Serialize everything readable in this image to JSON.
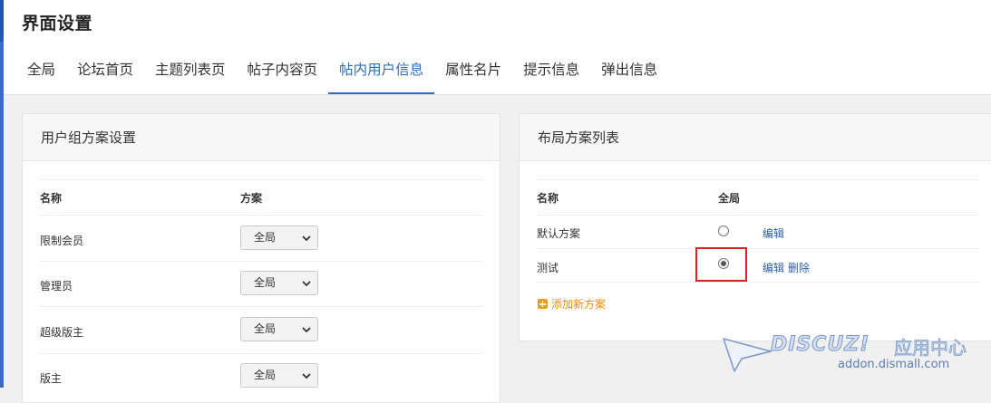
{
  "page": {
    "title": "界面设置"
  },
  "tabs": [
    {
      "label": "全局",
      "active": false
    },
    {
      "label": "论坛首页",
      "active": false
    },
    {
      "label": "主题列表页",
      "active": false
    },
    {
      "label": "帖子内容页",
      "active": false
    },
    {
      "label": "帖内用户信息",
      "active": true
    },
    {
      "label": "属性名片",
      "active": false
    },
    {
      "label": "提示信息",
      "active": false
    },
    {
      "label": "弹出信息",
      "active": false
    }
  ],
  "usergroup_panel": {
    "title": "用户组方案设置",
    "columns": [
      "名称",
      "方案"
    ],
    "rows": [
      {
        "name": "限制会员",
        "scheme": "全局"
      },
      {
        "name": "管理员",
        "scheme": "全局"
      },
      {
        "name": "超级版主",
        "scheme": "全局"
      },
      {
        "name": "版主",
        "scheme": "全局"
      }
    ]
  },
  "layout_panel": {
    "title": "布局方案列表",
    "columns": [
      "名称",
      "全局"
    ],
    "rows": [
      {
        "name": "默认方案",
        "global_selected": false,
        "edit": "编辑",
        "delete": ""
      },
      {
        "name": "测试",
        "global_selected": true,
        "edit": "编辑",
        "delete": "删除"
      }
    ],
    "add_label": "添加新方案"
  },
  "watermark": {
    "brand": "DISCUZ!",
    "brand_cn": "应用中心",
    "url": "addon.dismall.com"
  },
  "colors": {
    "accent": "#2b6fc2",
    "link": "#2b5fa8",
    "add": "#f08c0c",
    "highlight": "#e02020"
  },
  "icons": {
    "select_arrow": "chevron-down-icon",
    "add": "plus-square-icon",
    "watermark": "paper-plane-icon"
  }
}
